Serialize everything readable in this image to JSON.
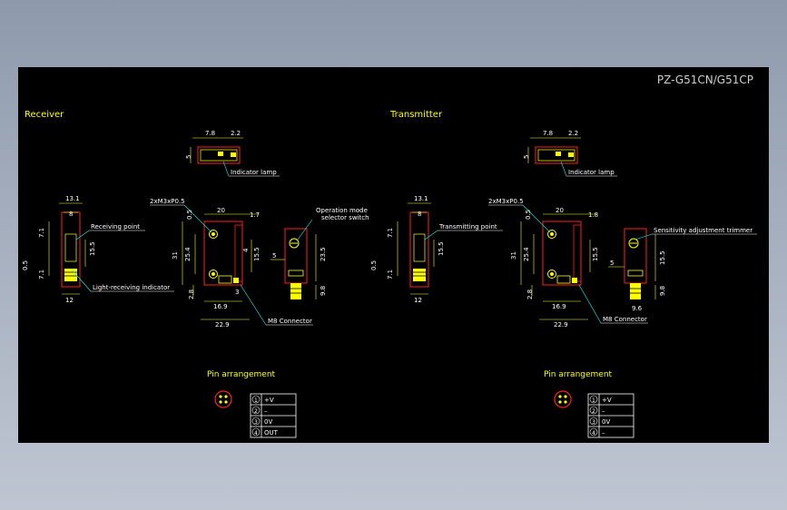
{
  "drawing": {
    "title": "PZ-G51CN/G51CP",
    "colors": {
      "background": "#000000",
      "text": "#ffffff",
      "dim": "#ffff00",
      "body": "#ff2020",
      "accent": "#00ffff",
      "title": "#d0d0d0"
    }
  },
  "receiver": {
    "heading": "Receiver",
    "top_view": {
      "dim_a": "7.8",
      "dim_b": "2.2",
      "dim_side": "5",
      "callout": "Indicator lamp"
    },
    "side_view": {
      "w_top": "13.1",
      "w_inner": "8",
      "h_top": "7.1",
      "h_gap": "0.5",
      "h_low": "7.1",
      "w_bottom": "12",
      "callout_top": "Receiving point",
      "callout_bottom": "Light-receiving indicator"
    },
    "front_view": {
      "thread": "2xM3xP0.5",
      "w_top": "20",
      "gap": "1.7",
      "h_left": "0.5",
      "h_total": "31",
      "h_pitch": "25.4",
      "h_right": "15.5",
      "dim_small": "4",
      "h_bottom": "2.8",
      "dim_three": "3",
      "w_mid": "16.9",
      "w_bottom": "22.9",
      "callout": "M8 Connector"
    },
    "right_view": {
      "callout_line1": "Operation mode",
      "callout_line2": "selector switch",
      "dim_side": "5",
      "h_right": "23.5",
      "h_bottom": "9.8"
    },
    "pins": {
      "heading": "Pin arrangement",
      "rows": [
        {
          "num": "1",
          "label": "+V"
        },
        {
          "num": "2",
          "label": "–"
        },
        {
          "num": "3",
          "label": "0V"
        },
        {
          "num": "4",
          "label": "OUT"
        }
      ]
    }
  },
  "transmitter": {
    "heading": "Transmitter",
    "top_view": {
      "dim_a": "7.8",
      "dim_b": "2.2",
      "dim_side": "5",
      "callout": "Indicator lamp"
    },
    "side_view": {
      "w_top": "13.1",
      "w_inner": "8",
      "h_top": "7.1",
      "h_gap": "0.5",
      "h_low": "7.1",
      "w_bottom": "12",
      "callout_top": "Transmitting point"
    },
    "front_view": {
      "thread": "2xM3xP0.5",
      "w_top": "20",
      "gap": "1.8",
      "h_left": "0.5",
      "h_total": "31",
      "h_pitch": "25.4",
      "h_right": "15.5",
      "h_bottom": "2.8",
      "w_mid": "16.9",
      "w_bottom": "22.9",
      "callout": "M8 Connector"
    },
    "right_view": {
      "callout": "Sensitivity adjustment trimmer",
      "dim_side": "5",
      "h_right": "15.5",
      "h_bottom": "9.8",
      "w_bottom": "9.6"
    },
    "pins": {
      "heading": "Pin arrangement",
      "rows": [
        {
          "num": "1",
          "label": "+V"
        },
        {
          "num": "2",
          "label": "–"
        },
        {
          "num": "3",
          "label": "0V"
        },
        {
          "num": "4",
          "label": "–"
        }
      ]
    }
  }
}
